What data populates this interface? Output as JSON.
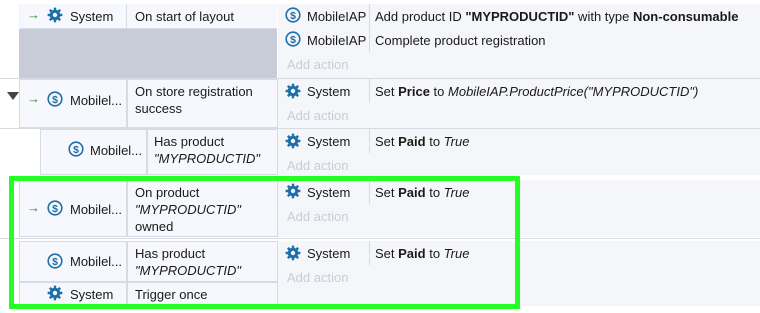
{
  "events": [
    {
      "condition": {
        "icon": "gear-icon",
        "object": "System",
        "text": "On start of layout"
      },
      "actions": [
        {
          "icon": "dollar-circle-icon",
          "object": "MobileIAP",
          "text_parts": [
            "Add product ID ",
            "\"MYPRODUCTID\"",
            " with type ",
            "Non-consumable"
          ]
        },
        {
          "icon": "dollar-circle-icon",
          "object": "MobileIAP",
          "text": "Complete product registration"
        }
      ],
      "add_action": "Add action"
    },
    {
      "condition": {
        "icon": "dollar-circle-icon",
        "object": "Mobilel...",
        "text_line1": "On store registration",
        "text_line2": "success"
      },
      "actions": [
        {
          "icon": "gear-icon",
          "object": "System",
          "text_parts": [
            "Set ",
            "Price",
            " to ",
            "MobileIAP.ProductPrice(\"MYPRODUCTID\")"
          ]
        }
      ],
      "add_action": "Add action"
    },
    {
      "condition": {
        "icon": "dollar-circle-icon",
        "object": "Mobilel...",
        "text_line1": "Has product",
        "text_line2": "\"MYPRODUCTID\""
      },
      "actions": [
        {
          "icon": "gear-icon",
          "object": "System",
          "text_parts": [
            "Set ",
            "Paid",
            " to ",
            "True"
          ]
        }
      ],
      "add_action": "Add action"
    },
    {
      "condition": {
        "icon": "dollar-circle-icon",
        "object": "Mobilel...",
        "text_line1": "On product",
        "text_line2": "\"MYPRODUCTID\"",
        "text_line3": "owned"
      },
      "actions": [
        {
          "icon": "gear-icon",
          "object": "System",
          "text_parts": [
            "Set ",
            "Paid",
            " to ",
            "True"
          ]
        }
      ],
      "add_action": "Add action"
    },
    {
      "condition": {
        "icon": "dollar-circle-icon",
        "object": "Mobilel...",
        "text_line1": "Has product",
        "text_line2": "\"MYPRODUCTID\""
      },
      "condition2": {
        "icon": "gear-icon",
        "object": "System",
        "text": "Trigger once"
      },
      "actions": [
        {
          "icon": "gear-icon",
          "object": "System",
          "text_parts": [
            "Set ",
            "Paid",
            " to ",
            "True"
          ]
        }
      ],
      "add_action": "Add action"
    }
  ],
  "colors": {
    "highlight": "#22ff22",
    "trigger_arrow": "#2e8b2e",
    "icon_blue": "#1d6fa8"
  }
}
